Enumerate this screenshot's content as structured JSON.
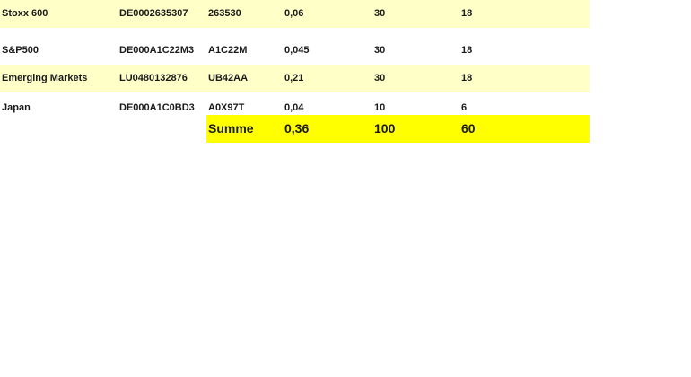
{
  "rows": [
    {
      "name": "Stoxx 600",
      "isin": "DE0002635307",
      "wkn": "263530",
      "ter": "0,06",
      "a": "30",
      "b": "18",
      "shaded": true
    },
    {
      "name": "S&P500",
      "isin": "DE000A1C22M3",
      "wkn": "A1C22M",
      "ter": "0,045",
      "a": "30",
      "b": "18",
      "shaded": false
    },
    {
      "name": "Emerging Markets",
      "isin": "LU0480132876",
      "wkn": "UB42AA",
      "ter": "0,21",
      "a": "30",
      "b": "18",
      "shaded": true
    },
    {
      "name": "Japan",
      "isin": "DE000A1C0BD3",
      "wkn": "A0X97T",
      "ter": "0,04",
      "a": "10",
      "b": "6",
      "shaded": false
    }
  ],
  "summary": {
    "label": "Summe",
    "ter": "0,36",
    "a": "100",
    "b": "60"
  },
  "colors": {
    "row_shade": "#ffffc8",
    "summary_highlight": "#ffff00"
  }
}
